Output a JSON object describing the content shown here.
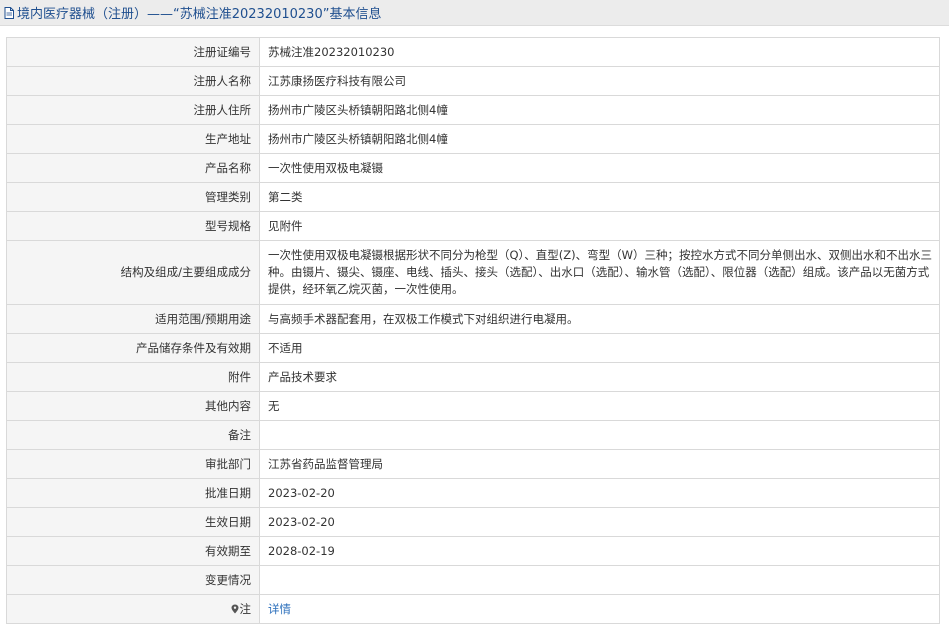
{
  "header": {
    "title": "境内医疗器械（注册）——“苏械注准20232010230”基本信息"
  },
  "rows": [
    {
      "label": "注册证编号",
      "value": "苏械注准20232010230"
    },
    {
      "label": "注册人名称",
      "value": "江苏康扬医疗科技有限公司"
    },
    {
      "label": "注册人住所",
      "value": "扬州市广陵区头桥镇朝阳路北侧4幢"
    },
    {
      "label": "生产地址",
      "value": "扬州市广陵区头桥镇朝阳路北侧4幢"
    },
    {
      "label": "产品名称",
      "value": "一次性使用双极电凝镊"
    },
    {
      "label": "管理类别",
      "value": "第二类"
    },
    {
      "label": "型号规格",
      "value": "见附件"
    },
    {
      "label": "结构及组成/主要组成成分",
      "value": "一次性使用双极电凝镊根据形状不同分为枪型（Q）、直型(Z)、弯型（W）三种；按控水方式不同分单侧出水、双侧出水和不出水三种。由镊片、镊尖、镊座、电线、插头、接头（选配）、出水口（选配）、输水管（选配）、限位器（选配）组成。该产品以无菌方式提供，经环氧乙烷灭菌，一次性使用。"
    },
    {
      "label": "适用范围/预期用途",
      "value": "与高频手术器配套用，在双极工作模式下对组织进行电凝用。"
    },
    {
      "label": "产品储存条件及有效期",
      "value": "不适用"
    },
    {
      "label": "附件",
      "value": "产品技术要求"
    },
    {
      "label": "其他内容",
      "value": "无"
    },
    {
      "label": "备注",
      "value": ""
    },
    {
      "label": "审批部门",
      "value": "江苏省药品监督管理局"
    },
    {
      "label": "批准日期",
      "value": "2023-02-20"
    },
    {
      "label": "生效日期",
      "value": "2023-02-20"
    },
    {
      "label": "有效期至",
      "value": "2028-02-19"
    },
    {
      "label": "变更情况",
      "value": ""
    }
  ],
  "note_row": {
    "label": "注",
    "icon": "map-pin-icon",
    "link_text": "详情"
  },
  "colors": {
    "title": "#1f4f8f",
    "link": "#2a6ebb",
    "label_bg": "#f5f5f5",
    "border": "#d9d9d9"
  }
}
